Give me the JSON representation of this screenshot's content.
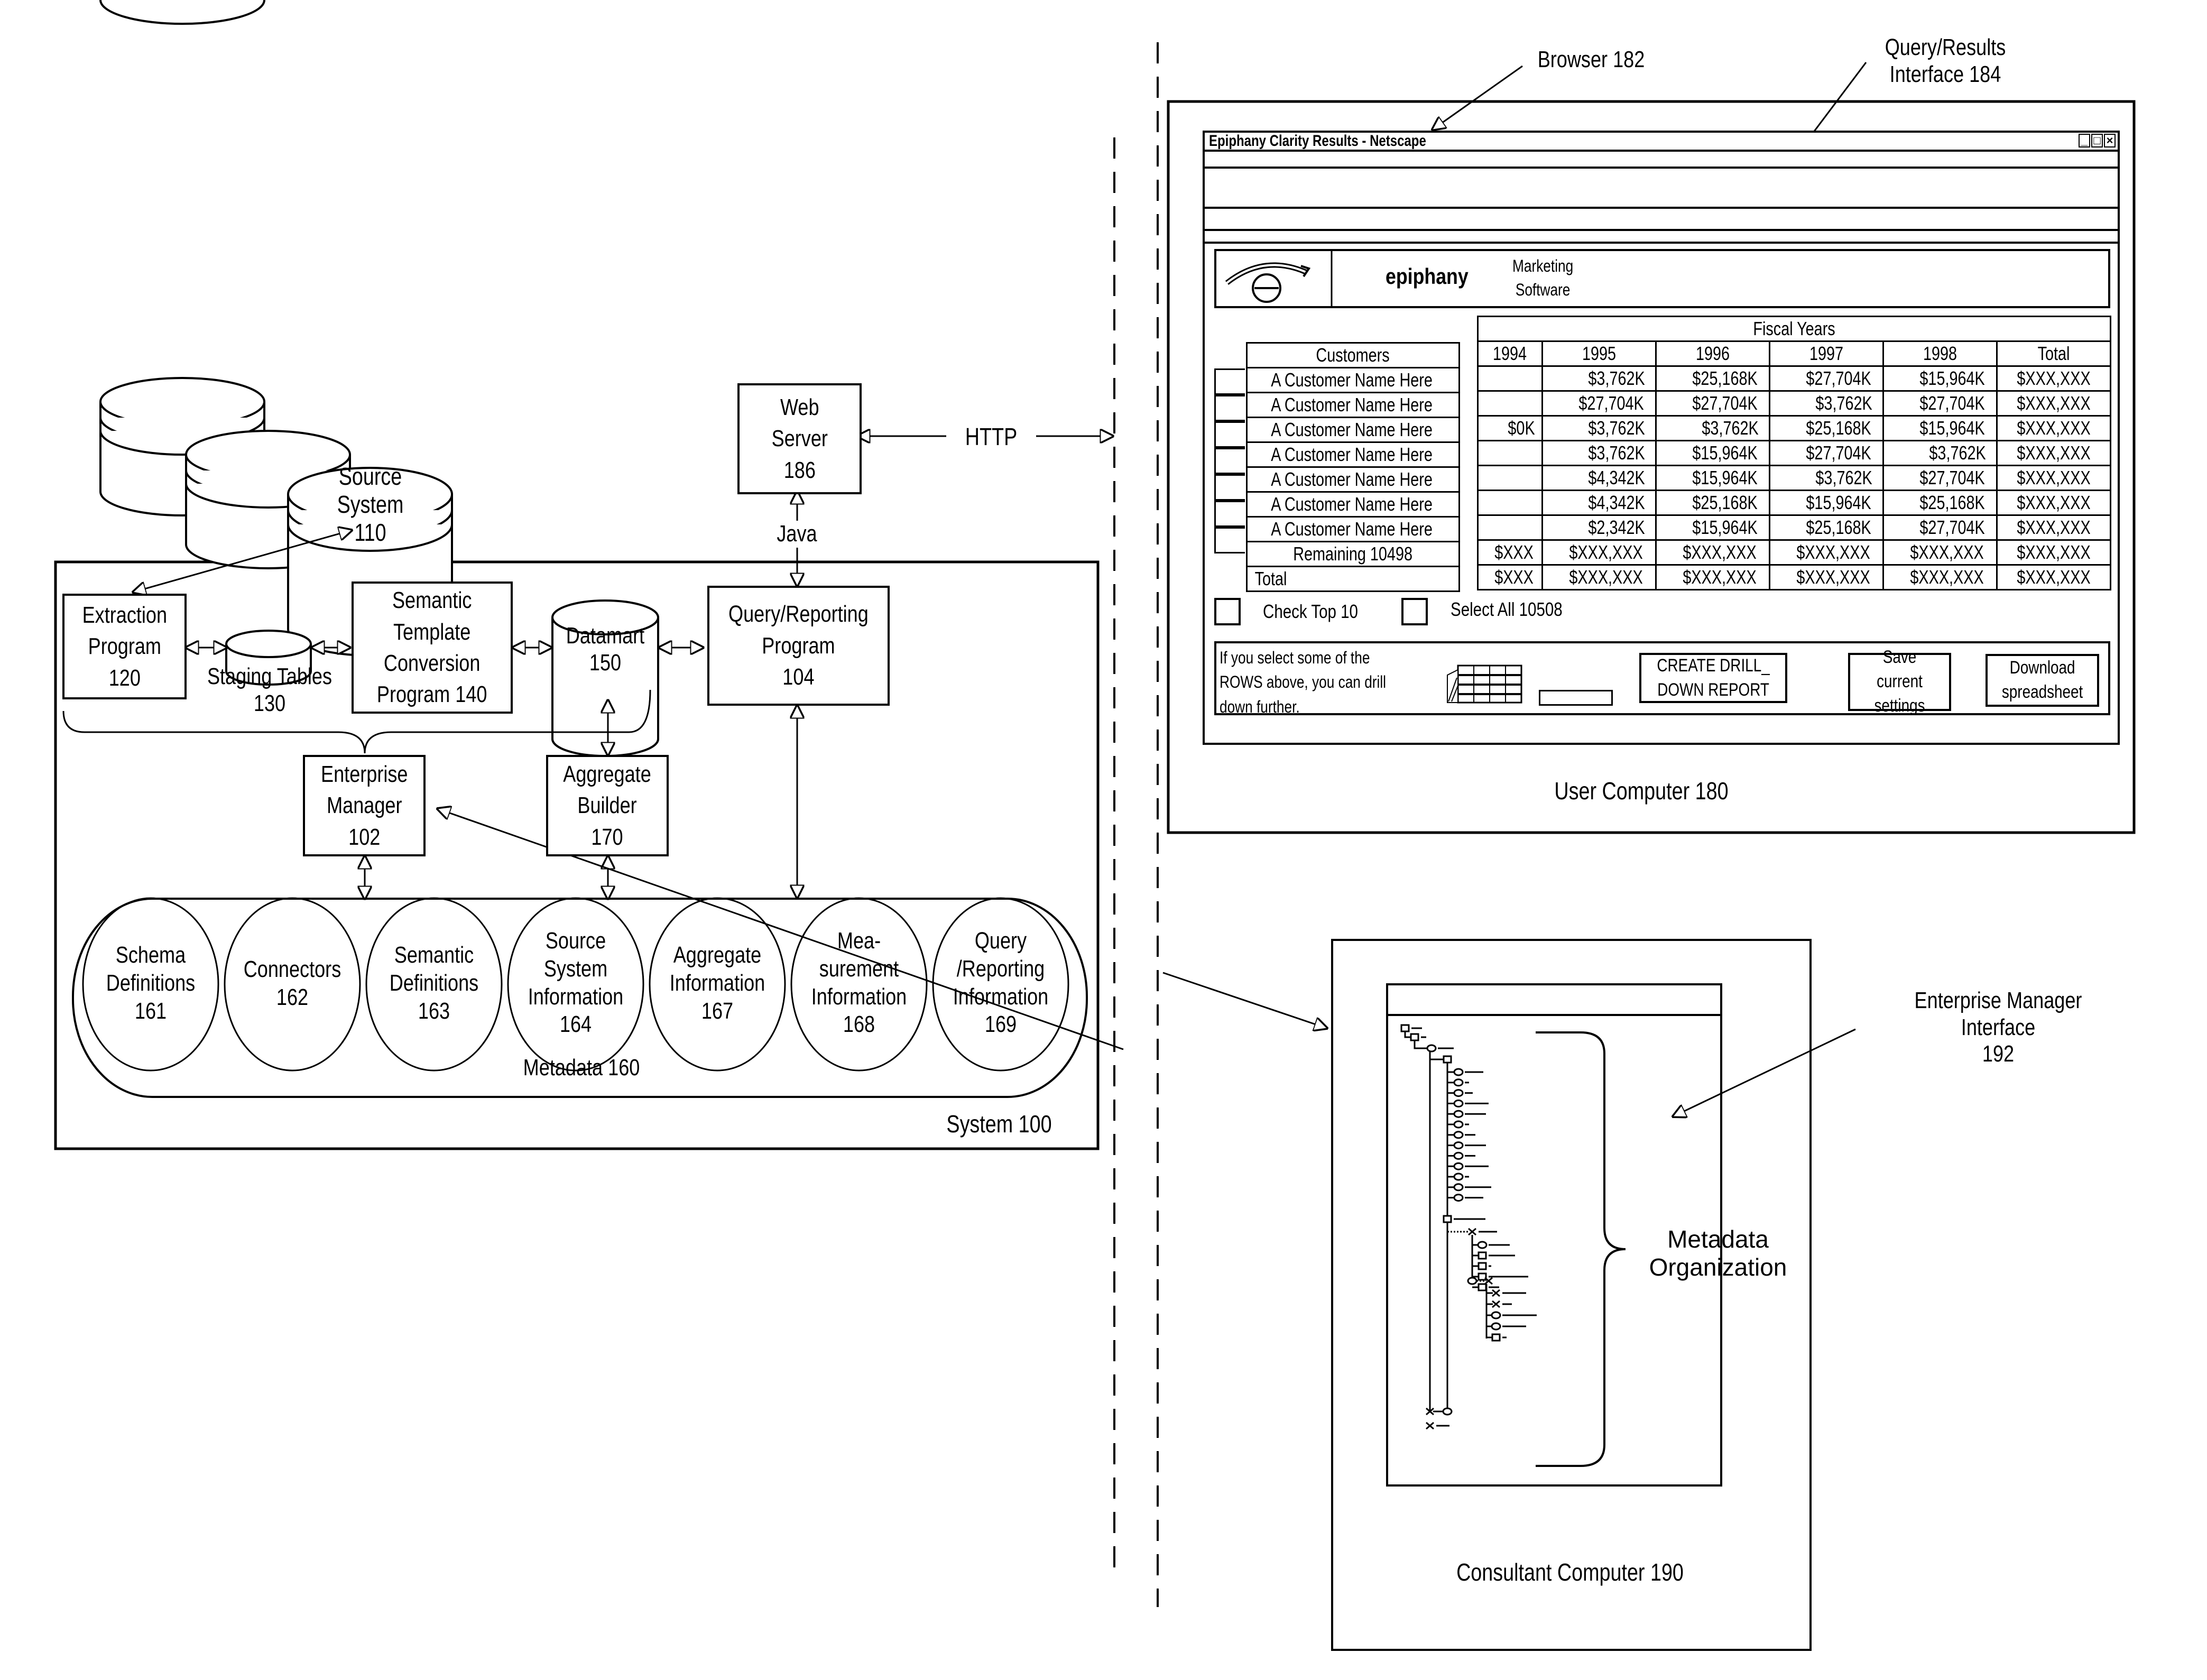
{
  "system": {
    "label": "System 100",
    "source_system": "Source System\n110",
    "web_server": "Web\nServer\n186",
    "http_label": "HTTP",
    "java_label": "Java",
    "extraction_program": "Extraction\nProgram\n120",
    "staging_tables": "Staging Tables\n130",
    "semantic_template": "Semantic\nTemplate\nConversion\nProgram 140",
    "datamart": "Datamart\n150",
    "query_reporting_program": "Query/Reporting\nProgram\n104",
    "enterprise_manager": "Enterprise\nManager\n102",
    "aggregate_builder": "Aggregate\nBuilder\n170",
    "metadata": {
      "label": "Metadata 160",
      "items": [
        {
          "label": "Schema\nDefinitions\n161"
        },
        {
          "label": "Connectors\n162"
        },
        {
          "label": "Semantic\nDefinitions\n163"
        },
        {
          "label": "Source\nSystem\nInformation\n164"
        },
        {
          "label": "Aggregate\nInformation\n167"
        },
        {
          "label": "Mea-\nsurement\nInformation\n168"
        },
        {
          "label": "Query\n/Reporting\nInformation\n169"
        }
      ]
    }
  },
  "user_computer": {
    "label": "User Computer 180",
    "browser_callout": "Browser 182",
    "query_results_callout": "Query/Results\nInterface 184",
    "window": {
      "title": "Epiphany Clarity Results - Netscape",
      "controls": {
        "minimize": "_",
        "maximize": "□",
        "close": "×"
      },
      "brand_name": "epiphany",
      "brand_tagline": "Marketing\nSoftware",
      "table": {
        "group_header": "Fiscal Years",
        "row_header": "Customers",
        "columns": [
          "1994",
          "1995",
          "1996",
          "1997",
          "1998",
          "Total"
        ],
        "rows": [
          {
            "name": "A Customer Name Here",
            "values": [
              "",
              "$3,762K",
              "$25,168K",
              "$27,704K",
              "$15,964K",
              "$XXX,XXX"
            ]
          },
          {
            "name": "A Customer Name Here",
            "values": [
              "",
              "$27,704K",
              "$27,704K",
              "$3,762K",
              "$27,704K",
              "$XXX,XXX"
            ]
          },
          {
            "name": "A Customer Name Here",
            "values": [
              "$0K",
              "$3,762K",
              "$3,762K",
              "$25,168K",
              "$15,964K",
              "$XXX,XXX"
            ]
          },
          {
            "name": "A Customer Name Here",
            "values": [
              "",
              "$3,762K",
              "$15,964K",
              "$27,704K",
              "$3,762K",
              "$XXX,XXX"
            ]
          },
          {
            "name": "A Customer Name Here",
            "values": [
              "",
              "$4,342K",
              "$15,964K",
              "$3,762K",
              "$27,704K",
              "$XXX,XXX"
            ]
          },
          {
            "name": "A Customer Name Here",
            "values": [
              "",
              "$4,342K",
              "$25,168K",
              "$15,964K",
              "$25,168K",
              "$XXX,XXX"
            ]
          },
          {
            "name": "A Customer Name Here",
            "values": [
              "",
              "$2,342K",
              "$15,964K",
              "$25,168K",
              "$27,704K",
              "$XXX,XXX"
            ]
          }
        ],
        "remaining": {
          "name": "Remaining 10498",
          "values": [
            "$XXX",
            "$XXX,XXX",
            "$XXX,XXX",
            "$XXX,XXX",
            "$XXX,XXX",
            "$XXX,XXX"
          ]
        },
        "total": {
          "name": "Total",
          "values": [
            "$XXX",
            "$XXX,XXX",
            "$XXX,XXX",
            "$XXX,XXX",
            "$XXX,XXX",
            "$XXX,XXX"
          ]
        }
      },
      "check_top_10": "Check Top 10",
      "select_all": "Select All 10508",
      "drill_hint": "If you select some of the\nROWS above, you can drill\ndown further.",
      "create_drill_button": "CREATE DRILL_\nDOWN REPORT",
      "save_settings_button": "Save current\nsettings",
      "download_button": "Download\nspreadsheet"
    }
  },
  "consultant_computer": {
    "label": "Consultant Computer 190",
    "interface_callout": "Enterprise Manager Interface\n192",
    "metadata_organization": "Metadata\nOrganization"
  }
}
